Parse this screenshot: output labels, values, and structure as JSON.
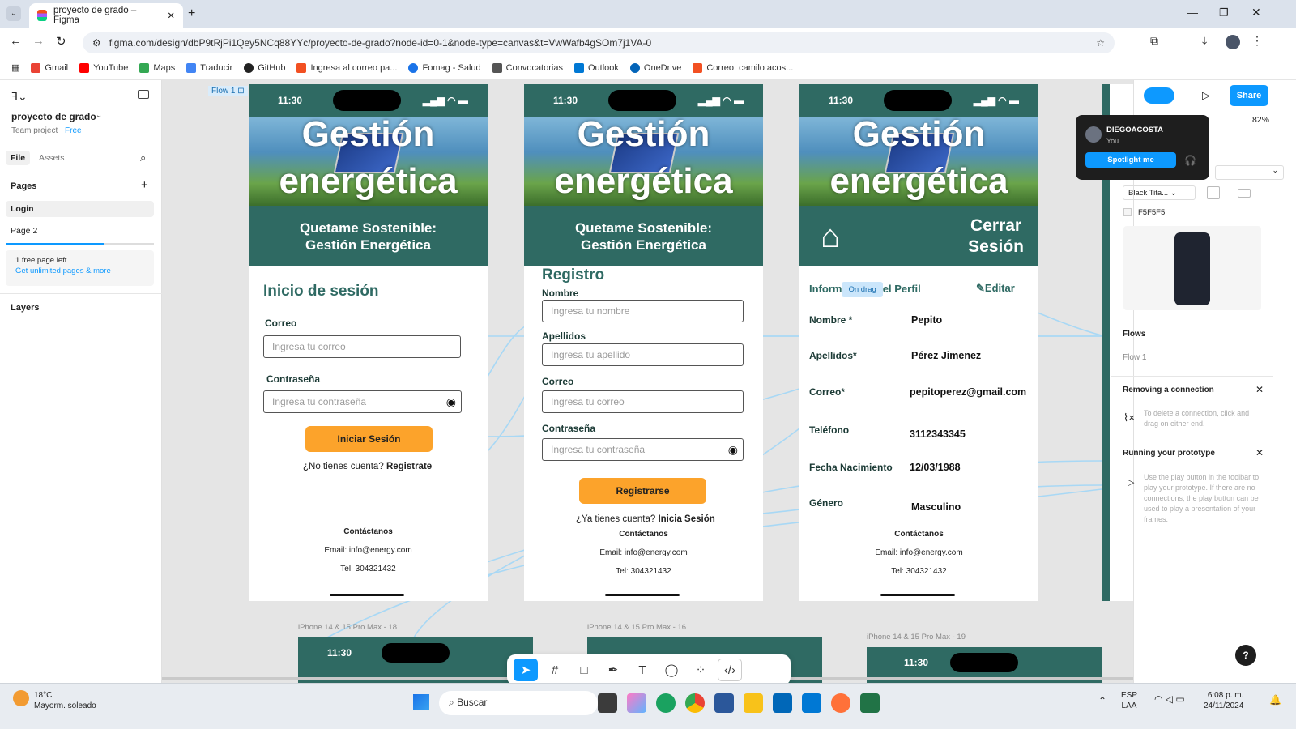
{
  "browser": {
    "tab_title": "proyecto de grado – Figma",
    "url": "figma.com/design/dbP9tRjPi1Qey5NCq88YYc/proyecto-de-grado?node-id=0-1&node-type=canvas&t=VwWafb4gSOm7j1VA-0",
    "bookmarks": [
      "Gmail",
      "YouTube",
      "Maps",
      "Traducir",
      "GitHub",
      "Ingresa al correo pa...",
      "Fomag - Salud",
      "Convocatorias",
      "Outlook",
      "OneDrive",
      "Correo: camilo acos..."
    ]
  },
  "figma": {
    "file_name": "proyecto de grado",
    "team": "Team project",
    "plan_badge": "Free",
    "tabs": [
      "File",
      "Assets"
    ],
    "pages_heading": "Pages",
    "pages": [
      "Login",
      "Page 2"
    ],
    "pages_note": "1 free page left.",
    "pages_link": "Get unlimited pages & more",
    "layers_heading": "Layers",
    "flow_label": "Flow 1"
  },
  "phone": {
    "time": "11:30",
    "hero_line1": "Gestión",
    "hero_line2": "energética",
    "band_line1": "Quetame Sostenible:",
    "band_line2": "Gestión Energética",
    "footer": {
      "title": "Contáctanos",
      "email": "Email: info@energy.com",
      "tel": "Tel: 304321432"
    }
  },
  "login": {
    "title": "Inicio de sesión",
    "email_label": "Correo",
    "email_placeholder": "Ingresa tu correo",
    "password_label": "Contraseña",
    "password_placeholder": "Ingresa tu contraseña",
    "submit": "Iniciar Sesión",
    "no_account": "¿No tienes cuenta?",
    "register_link": "Registrate"
  },
  "register": {
    "title": "Registro",
    "name_label": "Nombre",
    "name_placeholder": "Ingresa tu nombre",
    "last_label": "Apellidos",
    "last_placeholder": "Ingresa tu apellido",
    "email_label": "Correo",
    "email_placeholder": "Ingresa tu correo",
    "password_label": "Contraseña",
    "password_placeholder": "Ingresa tu contraseña",
    "submit": "Registrarse",
    "have_account": "¿Ya tienes cuenta?",
    "login_link": "Inicia Sesión"
  },
  "profile": {
    "logout_line1": "Cerrar",
    "logout_line2": "Sesión",
    "info_title_a": "Inform",
    "on_drag": "On drag",
    "info_title_b": "el Perfil",
    "edit": "Editar",
    "rows": [
      {
        "label": "Nombre *",
        "value": "Pepito"
      },
      {
        "label": "Apellidos*",
        "value": "Pérez  Jimenez"
      },
      {
        "label": "Correo*",
        "value": "pepitoperez@gmail.com"
      },
      {
        "label": "Teléfono",
        "value": "3112343345"
      },
      {
        "label": "Fecha Nacimiento",
        "value": "12/03/1988"
      },
      {
        "label": "Género",
        "value": "Masculino"
      }
    ]
  },
  "frames_below": [
    "iPhone 14 & 15 Pro Max - 18",
    "iPhone 14 & 15 Pro Max - 16",
    "iPhone 14 & 15 Pro Max - 19"
  ],
  "right": {
    "share": "Share",
    "zoom": "82%",
    "user_name": "DIEGOACOSTA",
    "user_sub": "You",
    "spotlight": "Spotlight me",
    "device": "Black Tita...",
    "bg_color": "F5F5F5",
    "flows_heading": "Flows",
    "flow_item": "Flow 1",
    "tip1_title": "Removing a connection",
    "tip1_text": "To delete a connection, click and drag on either end.",
    "tip2_title": "Running your prototype",
    "tip2_text": "Use the play button in the toolbar to play your prototype. If there are no connections, the play button can be used to play a presentation of your frames."
  },
  "taskbar": {
    "temp": "18°C",
    "weather": "Mayorm. soleado",
    "search": "Buscar",
    "lang1": "ESP",
    "lang2": "LAA",
    "time": "6:08 p. m.",
    "date": "24/11/2024"
  },
  "colors": {
    "brand_green": "#2f6a63",
    "button_orange": "#fca32b",
    "figma_blue": "#0d99ff"
  }
}
